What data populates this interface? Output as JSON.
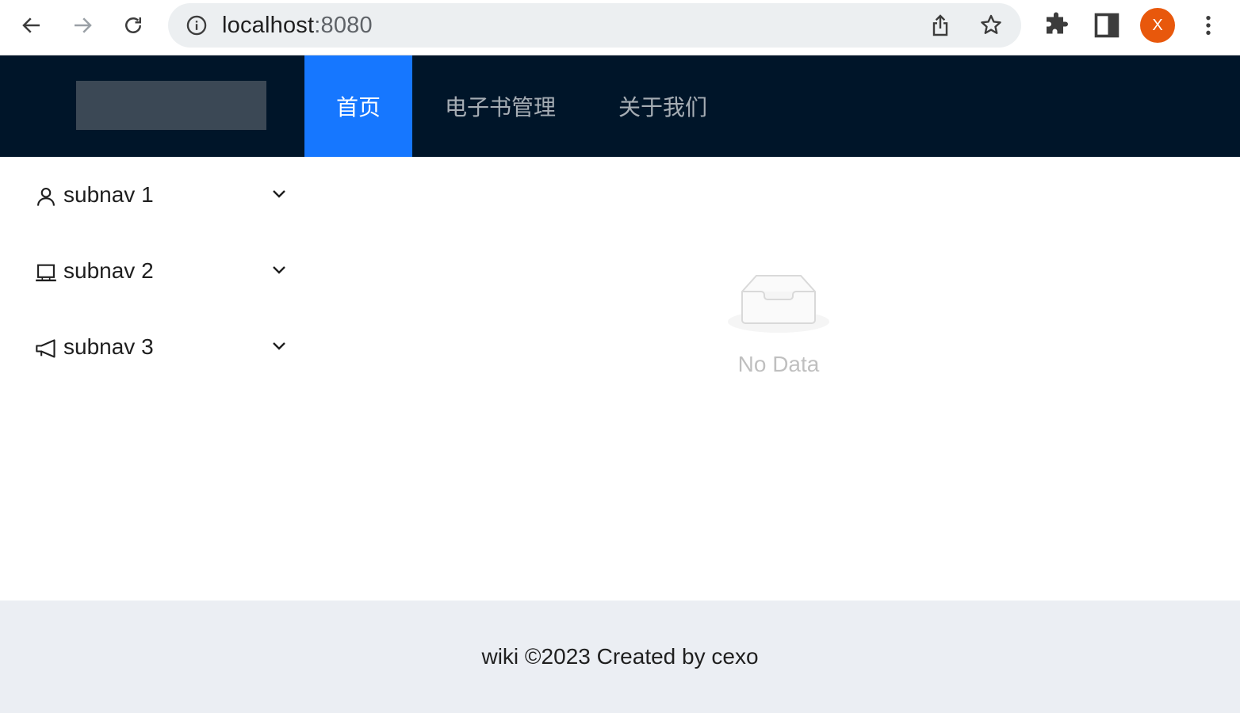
{
  "browser": {
    "url_host": "localhost",
    "url_port": ":8080",
    "profile_initial": "X",
    "icons": [
      "back-arrow-icon",
      "forward-arrow-icon",
      "reload-icon",
      "info-icon",
      "share-icon",
      "star-icon",
      "extensions-icon",
      "side-panel-icon",
      "menu-dots-icon"
    ],
    "avatar_color": "#e8580c"
  },
  "header": {
    "background": "#001529",
    "accent": "#1677ff",
    "menu": [
      {
        "label": "首页",
        "active": true
      },
      {
        "label": "电子书管理",
        "active": false
      },
      {
        "label": "关于我们",
        "active": false
      }
    ]
  },
  "sider": {
    "items": [
      {
        "label": "subnav 1",
        "icon": "user-icon"
      },
      {
        "label": "subnav 2",
        "icon": "laptop-icon"
      },
      {
        "label": "subnav 3",
        "icon": "notification-icon"
      }
    ]
  },
  "content": {
    "empty_text": "No Data",
    "empty_icon": "empty-inbox-icon"
  },
  "footer": {
    "text": "wiki ©2023 Created by cexo"
  }
}
